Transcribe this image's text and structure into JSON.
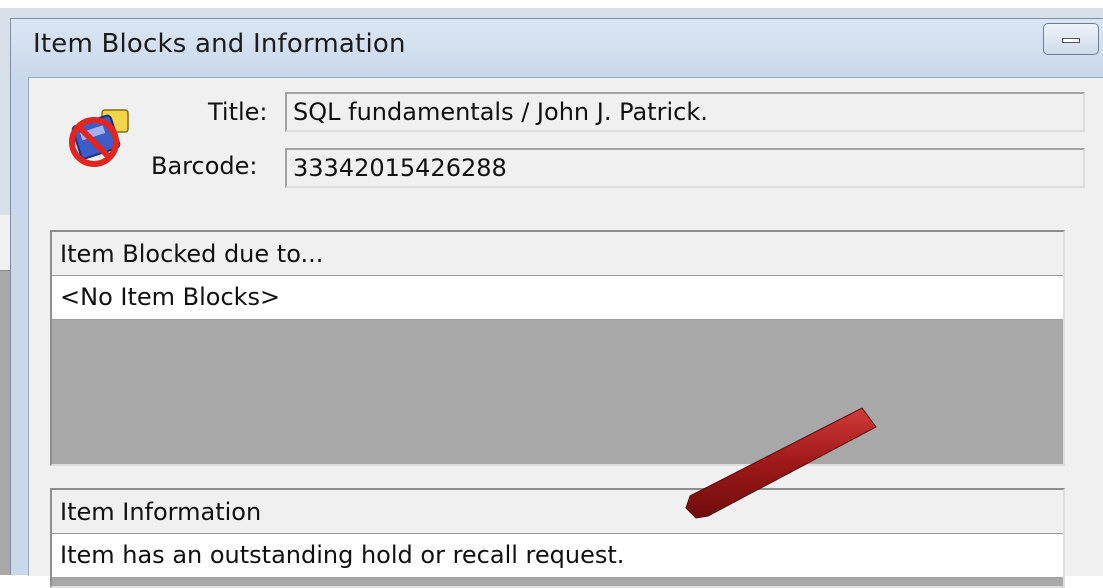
{
  "dialog": {
    "title": "Item Blocks and Information"
  },
  "fields": {
    "title_label": "Title:",
    "title_value": "SQL fundamentals / John J. Patrick.",
    "barcode_label": "Barcode:",
    "barcode_value": "33342015426288"
  },
  "blocks": {
    "header": "Item Blocked due to...",
    "rows": [
      "<No Item Blocks>"
    ]
  },
  "info": {
    "header": "Item Information",
    "rows": [
      "Item has an outstanding hold or recall request."
    ]
  },
  "icons": {
    "title_icon": "app-icon",
    "item_icon": "item-blocked-icon",
    "minimize": "minimize-icon",
    "annotation": "red-arrow-annotation"
  },
  "colors": {
    "arrow": "#a01818",
    "list_background": "#a8a8a8",
    "titlebar": "#c9d8ea"
  }
}
